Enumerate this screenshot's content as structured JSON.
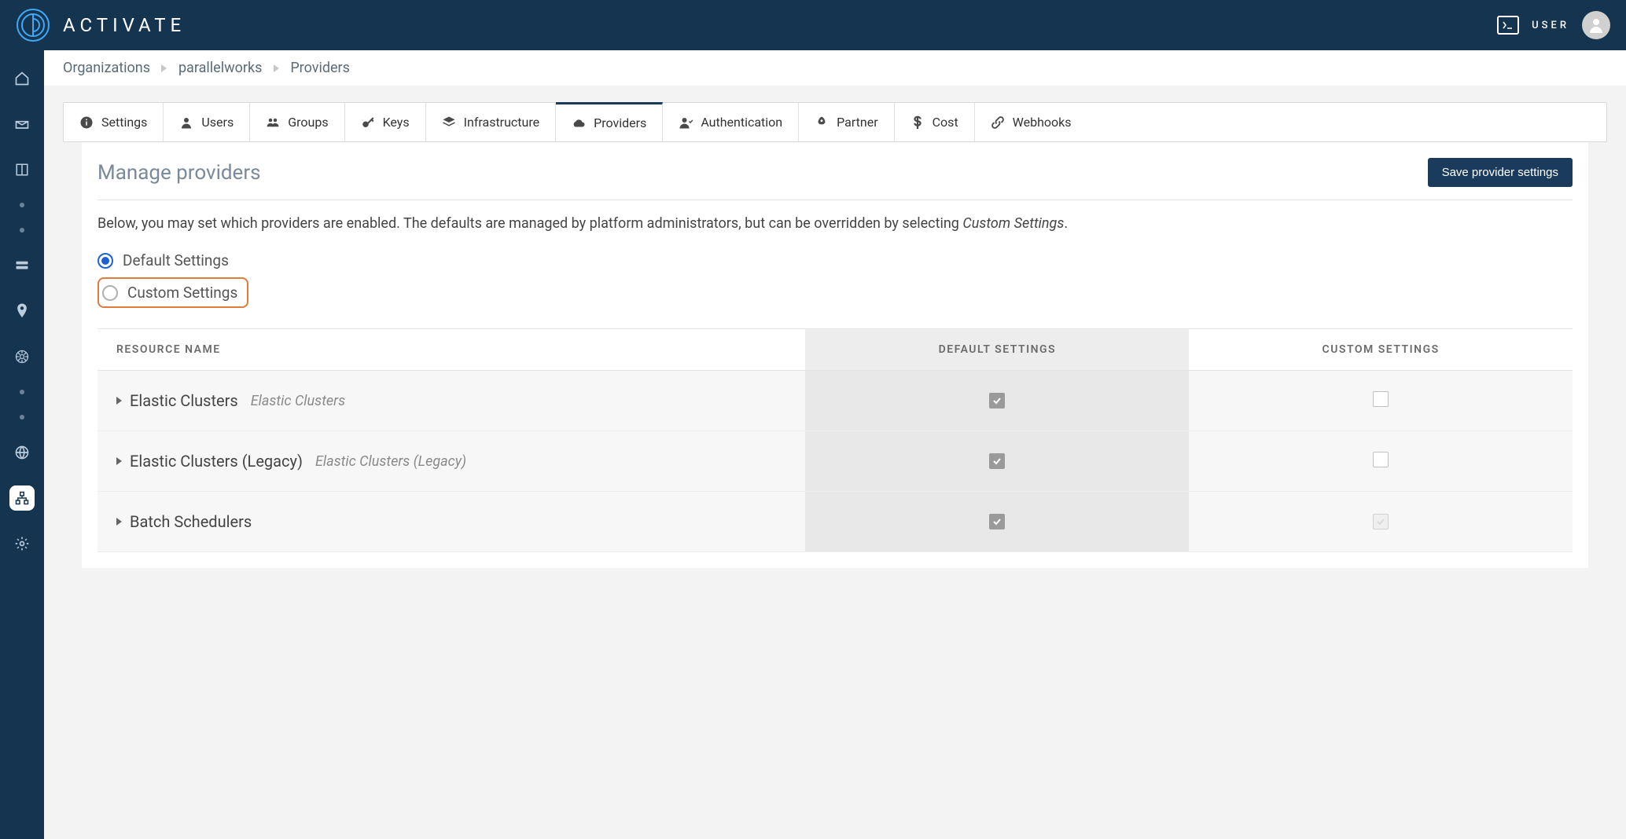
{
  "brand": {
    "name": "ACTIVATE"
  },
  "topbar": {
    "user_label": "USER"
  },
  "breadcrumb": {
    "items": [
      "Organizations",
      "parallelworks",
      "Providers"
    ]
  },
  "tabs": [
    {
      "label": "Settings",
      "icon": "info"
    },
    {
      "label": "Users",
      "icon": "user"
    },
    {
      "label": "Groups",
      "icon": "group"
    },
    {
      "label": "Keys",
      "icon": "key"
    },
    {
      "label": "Infrastructure",
      "icon": "layers"
    },
    {
      "label": "Providers",
      "icon": "cloud",
      "active": true
    },
    {
      "label": "Authentication",
      "icon": "auth"
    },
    {
      "label": "Partner",
      "icon": "rocket"
    },
    {
      "label": "Cost",
      "icon": "dollar"
    },
    {
      "label": "Webhooks",
      "icon": "link"
    }
  ],
  "panel": {
    "title": "Manage providers",
    "save_label": "Save provider settings",
    "description_pre": "Below, you may set which providers are enabled. The defaults are managed by platform administrators, but can be overridden by selecting ",
    "description_italic": "Custom Settings",
    "description_post": ".",
    "radios": {
      "default": "Default Settings",
      "custom": "Custom Settings"
    },
    "columns": {
      "resource": "RESOURCE NAME",
      "default": "DEFAULT SETTINGS",
      "custom": "CUSTOM SETTINGS"
    },
    "rows": [
      {
        "name": "Elastic Clusters",
        "sub": "Elastic Clusters",
        "default_on": true,
        "custom_on": false,
        "custom_light": false
      },
      {
        "name": "Elastic Clusters (Legacy)",
        "sub": "Elastic Clusters (Legacy)",
        "default_on": true,
        "custom_on": false,
        "custom_light": false
      },
      {
        "name": "Batch Schedulers",
        "sub": "",
        "default_on": true,
        "custom_on": false,
        "custom_light": true
      }
    ]
  }
}
